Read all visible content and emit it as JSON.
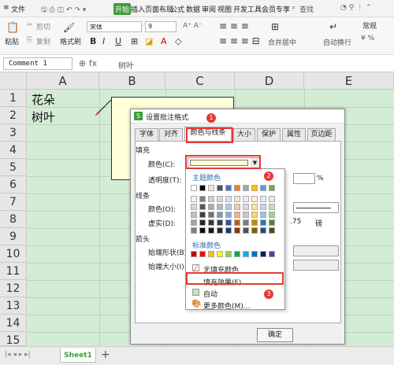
{
  "menubar": {
    "items": [
      "文件",
      "开始",
      "插入",
      "页面布局",
      "公式",
      "数据",
      "审阅",
      "视图",
      "开发工具",
      "会员专享"
    ],
    "search": "查找"
  },
  "ribbon": {
    "paste": "粘贴",
    "cut": "剪切",
    "copy": "复制",
    "format_painter": "格式刷",
    "font_name": "宋体",
    "font_size": "9",
    "merge_center": "合并居中",
    "auto_wrap": "自动换行",
    "general": "常规"
  },
  "formula": {
    "name_box": "Comment 1",
    "value": "树叶"
  },
  "sheet": {
    "columns": [
      "A",
      "B",
      "C",
      "D",
      "E"
    ],
    "rows": [
      "1",
      "2",
      "3",
      "4",
      "5",
      "6",
      "7",
      "8",
      "9",
      "10",
      "11",
      "12",
      "13",
      "14",
      "15"
    ],
    "cells": {
      "a1": "花朵",
      "a2": "树叶"
    }
  },
  "dialog": {
    "title": "设置批注格式",
    "tabs": [
      "字体",
      "对齐",
      "颜色与线条",
      "大小",
      "保护",
      "属性",
      "页边距"
    ],
    "fill_section": "填充",
    "color_label": "颜色(C):",
    "transparency_label": "透明度(T):",
    "percent": "%",
    "line_section": "线条",
    "line_color_label": "颜色(O):",
    "dashed_label": "虚实(D):",
    "weight_value": ".75",
    "weight_unit": "磅",
    "arrow_section": "箭头",
    "arrow_start_style": "始端形状(B):",
    "arrow_start_size": "始端大小(I):",
    "ok": "确定"
  },
  "dropdown": {
    "theme_colors": "主题颜色",
    "standard_colors": "标准颜色",
    "no_fill": "无填充颜色",
    "fill_effects": "填充效果(F)...",
    "auto": "自动",
    "more_colors": "更多颜色(M)..."
  },
  "badges": [
    "1",
    "2",
    "3"
  ],
  "statusbar": {
    "sheet_tab": "Sheet1",
    "add": "+"
  },
  "colors": {
    "accent": "#3e9b3e",
    "highlight": "#e53935",
    "sheet_bg": "#d4ecd4"
  }
}
